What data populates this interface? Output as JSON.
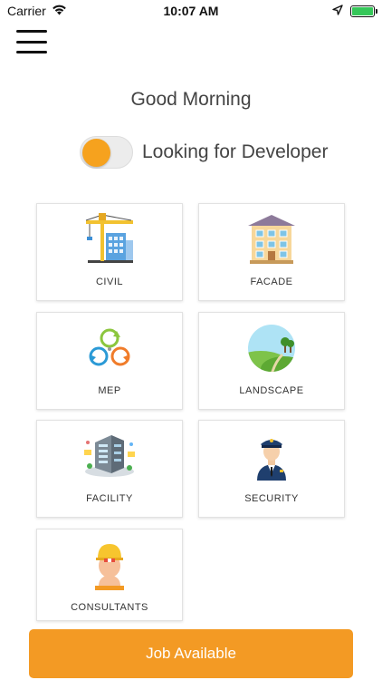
{
  "status_bar": {
    "carrier": "Carrier",
    "time": "10:07 AM",
    "icons": [
      "wifi-icon",
      "location-arrow-icon",
      "battery-icon"
    ]
  },
  "menu": {
    "icon": "hamburger-menu-icon"
  },
  "greeting": "Good Morning",
  "toggle": {
    "label": "Looking for Developer",
    "on": true,
    "knob_color": "#f6a21e"
  },
  "categories": [
    {
      "label": "CIVIL",
      "icon": "construction-crane-icon"
    },
    {
      "label": "FACADE",
      "icon": "building-facade-icon"
    },
    {
      "label": "MEP",
      "icon": "mep-cycle-arrows-icon"
    },
    {
      "label": "LANDSCAPE",
      "icon": "landscape-icon"
    },
    {
      "label": "FACILITY",
      "icon": "facility-building-icon"
    },
    {
      "label": "SECURITY",
      "icon": "security-guard-icon"
    },
    {
      "label": "CONSULTANTS",
      "icon": "consultant-hardhat-icon"
    }
  ],
  "action_button": {
    "label": "Job Available",
    "color": "#f39a24"
  }
}
